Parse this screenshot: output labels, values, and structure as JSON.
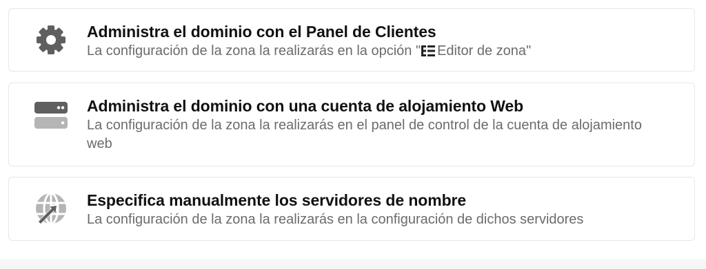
{
  "options": [
    {
      "icon": "gear-icon",
      "title": "Administra el dominio con el Panel de Clientes",
      "desc_prefix": "La configuración de la zona la realizarás en la opción \"",
      "desc_inline_icon": "zone-editor-icon",
      "desc_link": "Editor de zona",
      "desc_suffix": "\""
    },
    {
      "icon": "server-icon",
      "title": "Administra el dominio con una cuenta de alojamiento Web",
      "desc": "La configuración de la zona la realizarás en el panel de control de la cuenta de alojamiento web"
    },
    {
      "icon": "globe-arrow-icon",
      "title": "Especifica manualmente los servidores de nombre",
      "desc": "La configuración de la zona la realizarás en la configuración de dichos servidores"
    }
  ],
  "colors": {
    "icon_dark": "#5f5f5f",
    "icon_light": "#b5b5b5",
    "title": "#111111",
    "description": "#6b6b6b",
    "border": "#e7e7e7"
  }
}
